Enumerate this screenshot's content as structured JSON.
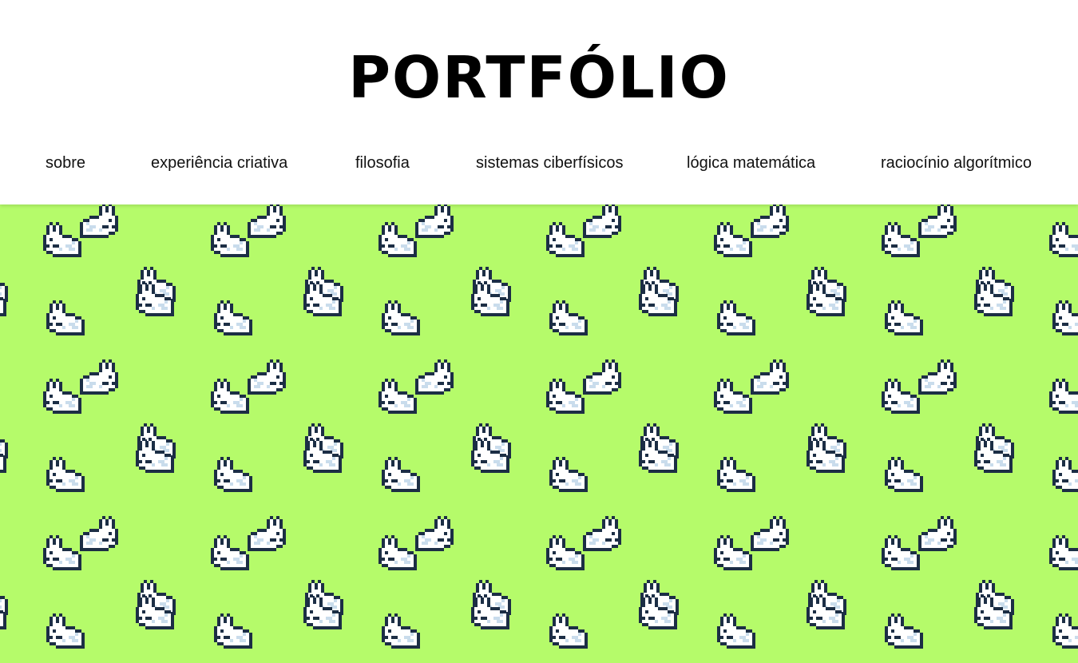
{
  "page": {
    "title": "PORTFÓLIO",
    "background_color": "#b5fb6a",
    "pattern_icon": "pixel-bunny-icon"
  },
  "nav": {
    "items": [
      {
        "label": "sobre"
      },
      {
        "label": "experiência criativa"
      },
      {
        "label": "filosofia"
      },
      {
        "label": "sistemas ciberfísicos"
      },
      {
        "label": "lógica matemática"
      },
      {
        "label": "raciocínio algorítmico"
      }
    ]
  }
}
